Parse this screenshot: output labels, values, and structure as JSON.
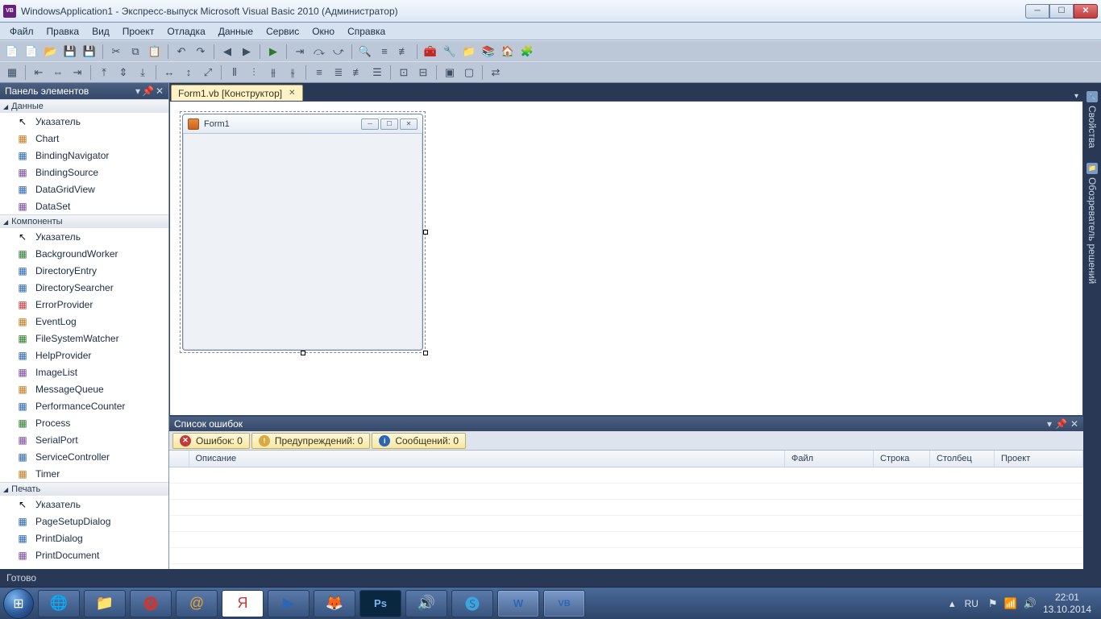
{
  "title": "WindowsApplication1 - Экспресс-выпуск Microsoft Visual Basic 2010 (Администратор)",
  "menu": [
    "Файл",
    "Правка",
    "Вид",
    "Проект",
    "Отладка",
    "Данные",
    "Сервис",
    "Окно",
    "Справка"
  ],
  "toolbox": {
    "title": "Панель элементов",
    "groups": [
      {
        "name": "Данные",
        "partial": true,
        "items": [
          {
            "icon": "ptr",
            "label": "Указатель"
          },
          {
            "icon": "c1",
            "label": "Chart"
          },
          {
            "icon": "c2",
            "label": "BindingNavigator"
          },
          {
            "icon": "c3",
            "label": "BindingSource"
          },
          {
            "icon": "c2",
            "label": "DataGridView"
          },
          {
            "icon": "c3",
            "label": "DataSet"
          }
        ]
      },
      {
        "name": "Компоненты",
        "items": [
          {
            "icon": "ptr",
            "label": "Указатель"
          },
          {
            "icon": "c5",
            "label": "BackgroundWorker"
          },
          {
            "icon": "c2",
            "label": "DirectoryEntry"
          },
          {
            "icon": "c2",
            "label": "DirectorySearcher"
          },
          {
            "icon": "c4",
            "label": "ErrorProvider"
          },
          {
            "icon": "c1",
            "label": "EventLog"
          },
          {
            "icon": "c5",
            "label": "FileSystemWatcher"
          },
          {
            "icon": "c2",
            "label": "HelpProvider"
          },
          {
            "icon": "c3",
            "label": "ImageList"
          },
          {
            "icon": "c1",
            "label": "MessageQueue"
          },
          {
            "icon": "c2",
            "label": "PerformanceCounter"
          },
          {
            "icon": "c5",
            "label": "Process"
          },
          {
            "icon": "c3",
            "label": "SerialPort"
          },
          {
            "icon": "c2",
            "label": "ServiceController"
          },
          {
            "icon": "c1",
            "label": "Timer"
          }
        ]
      },
      {
        "name": "Печать",
        "items": [
          {
            "icon": "ptr",
            "label": "Указатель"
          },
          {
            "icon": "c2",
            "label": "PageSetupDialog"
          },
          {
            "icon": "c2",
            "label": "PrintDialog"
          },
          {
            "icon": "c3",
            "label": "PrintDocument"
          }
        ]
      }
    ]
  },
  "doc_tab": "Form1.vb [Конструктор]",
  "form": {
    "title": "Form1"
  },
  "error_panel": {
    "title": "Список ошибок",
    "tabs": {
      "errors": "Ошибок: 0",
      "warnings": "Предупреждений: 0",
      "messages": "Сообщений: 0"
    },
    "columns": [
      "",
      "Описание",
      "Файл",
      "Строка",
      "Столбец",
      "Проект"
    ]
  },
  "right_rail": [
    "Свойства",
    "Обозреватель решений"
  ],
  "status": "Готово",
  "tray": {
    "lang": "RU",
    "time": "22:01",
    "date": "13.10.2014"
  }
}
